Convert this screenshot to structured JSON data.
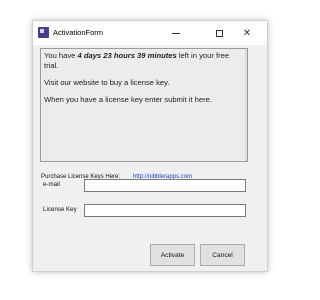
{
  "window": {
    "title": "ActivationForm",
    "controls": {
      "minimize": "minimize",
      "maximize": "maximize",
      "close": "close"
    }
  },
  "message": {
    "line1_prefix": "You have ",
    "line1_time": "4 days 23 hours 39 minutes",
    "line1_suffix": " left in your free trial.",
    "line2": "Visit our website to buy a license key.",
    "line3": "When you have a license key enter submit it here."
  },
  "purchase": {
    "label": "Purchase License Keys Here:",
    "link": "http://nibblerapps.com"
  },
  "form": {
    "email_label": "e-mail",
    "email_value": "",
    "license_label": "License Key",
    "license_value": ""
  },
  "buttons": {
    "activate": "Activate",
    "cancel": "Cancel"
  },
  "colors": {
    "app_icon": "#4b3a8c",
    "link": "#1a3ec7",
    "window_bg": "#f0f0f0"
  },
  "icons": {
    "app": "app-icon",
    "minimize": "minimize-icon",
    "maximize": "maximize-icon",
    "close": "close-icon"
  }
}
